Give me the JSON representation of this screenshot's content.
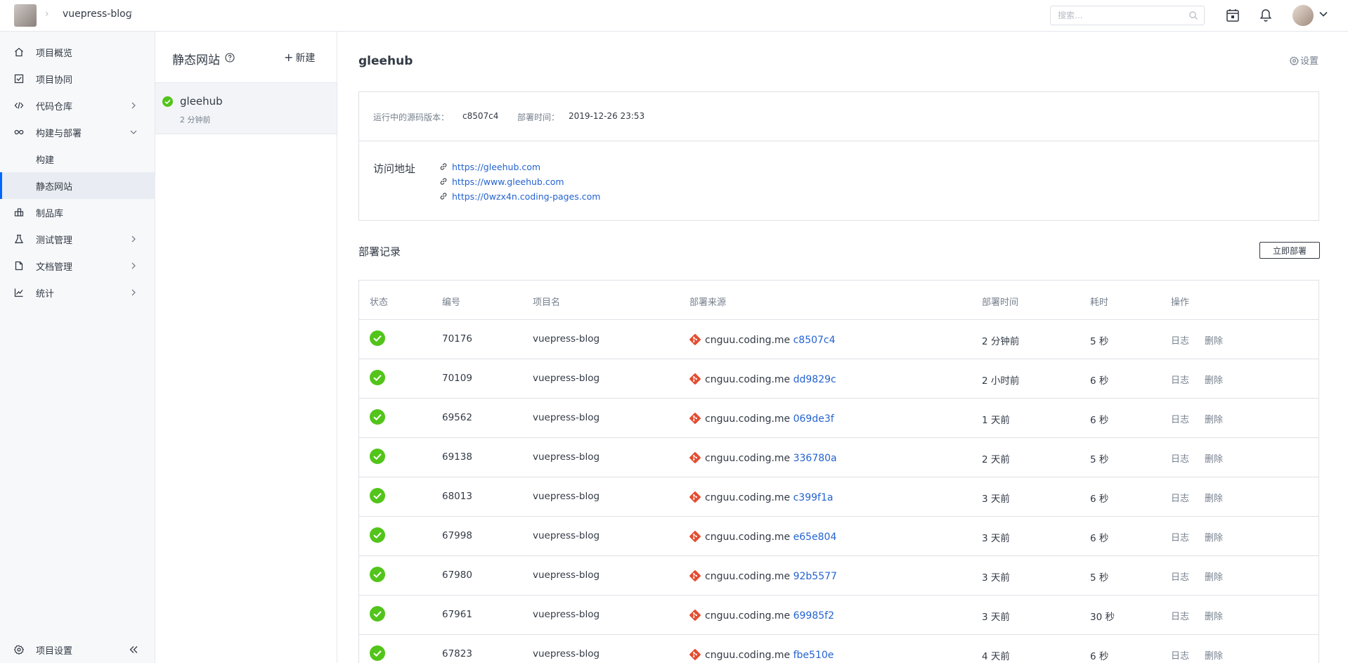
{
  "topbar": {
    "project_name": "vuepress-blog",
    "search_placeholder": "搜索..."
  },
  "nav": {
    "items": [
      {
        "label": "项目概览",
        "icon": "home-icon"
      },
      {
        "label": "项目协同",
        "icon": "checkbox-icon"
      },
      {
        "label": "代码仓库",
        "icon": "code-icon"
      },
      {
        "label": "构建与部署",
        "icon": "infinity-icon"
      },
      {
        "label": "构建",
        "icon": ""
      },
      {
        "label": "静态网站",
        "icon": ""
      },
      {
        "label": "制品库",
        "icon": "package-icon"
      },
      {
        "label": "测试管理",
        "icon": "flask-icon"
      },
      {
        "label": "文档管理",
        "icon": "document-icon"
      },
      {
        "label": "统计",
        "icon": "chart-icon"
      }
    ],
    "settings_label": "项目设置"
  },
  "sites_panel": {
    "title": "静态网站",
    "new_label": "新建",
    "site_name": "gleehub",
    "site_time": "2 分钟前"
  },
  "main": {
    "title": "gleehub",
    "settings_label": "设置",
    "source_version_label": "运行中的源码版本：",
    "source_version_value": "c8507c4",
    "deploy_time_label": "部署时间：",
    "deploy_time_value": "2019-12-26 23:53",
    "visit_label": "访问地址",
    "urls": [
      "https://gleehub.com",
      "https://www.gleehub.com",
      "https://0wzx4n.coding-pages.com"
    ],
    "records_title": "部署记录",
    "deploy_now_label": "立即部署"
  },
  "table": {
    "headers": [
      "状态",
      "编号",
      "项目名",
      "部署来源",
      "部署时间",
      "耗时",
      "操作"
    ],
    "log_label": "日志",
    "delete_label": "删除",
    "rows": [
      {
        "id": "70176",
        "project": "vuepress-blog",
        "source": "cnguu.coding.me",
        "hash": "c8507c4",
        "time": "2 分钟前",
        "duration": "5 秒"
      },
      {
        "id": "70109",
        "project": "vuepress-blog",
        "source": "cnguu.coding.me",
        "hash": "dd9829c",
        "time": "2 小时前",
        "duration": "6 秒"
      },
      {
        "id": "69562",
        "project": "vuepress-blog",
        "source": "cnguu.coding.me",
        "hash": "069de3f",
        "time": "1 天前",
        "duration": "6 秒"
      },
      {
        "id": "69138",
        "project": "vuepress-blog",
        "source": "cnguu.coding.me",
        "hash": "336780a",
        "time": "2 天前",
        "duration": "5 秒"
      },
      {
        "id": "68013",
        "project": "vuepress-blog",
        "source": "cnguu.coding.me",
        "hash": "c399f1a",
        "time": "3 天前",
        "duration": "6 秒"
      },
      {
        "id": "67998",
        "project": "vuepress-blog",
        "source": "cnguu.coding.me",
        "hash": "e65e804",
        "time": "3 天前",
        "duration": "6 秒"
      },
      {
        "id": "67980",
        "project": "vuepress-blog",
        "source": "cnguu.coding.me",
        "hash": "92b5577",
        "time": "3 天前",
        "duration": "5 秒"
      },
      {
        "id": "67961",
        "project": "vuepress-blog",
        "source": "cnguu.coding.me",
        "hash": "69985f2",
        "time": "3 天前",
        "duration": "30 秒"
      },
      {
        "id": "67823",
        "project": "vuepress-blog",
        "source": "cnguu.coding.me",
        "hash": "fbe510e",
        "time": "4 天前",
        "duration": "6 秒"
      }
    ]
  },
  "colors": {
    "accent": "#0066ff",
    "success": "#52c41a",
    "git": "#e44c30",
    "link": "#2463d1"
  }
}
